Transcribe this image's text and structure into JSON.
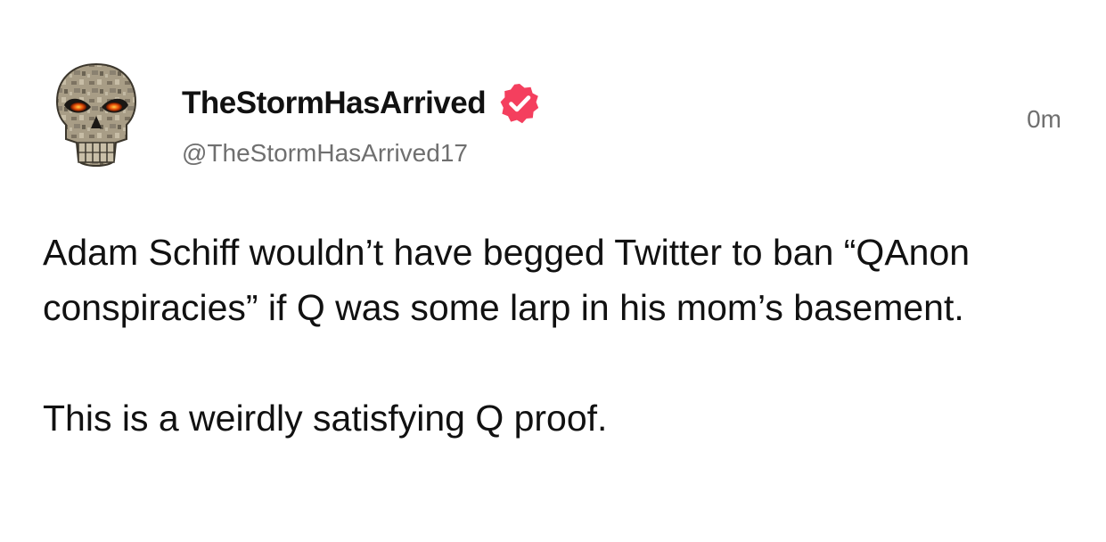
{
  "post": {
    "display_name": "TheStormHasArrived",
    "handle": "@TheStormHasArrived17",
    "timestamp": "0m",
    "verified_icon": "verified-badge-icon",
    "avatar_icon": "skull-avatar-icon",
    "paragraphs": [
      "Adam Schiff wouldn’t have begged Twitter to ban “QAnon conspiracies” if Q was some larp in his mom’s basement.",
      "This is a weirdly satisfying Q proof."
    ]
  },
  "colors": {
    "badge": "#f43f5e",
    "secondary_text": "#6f6f6f",
    "primary_text": "#111111",
    "skull_eye": "#e8520a"
  }
}
